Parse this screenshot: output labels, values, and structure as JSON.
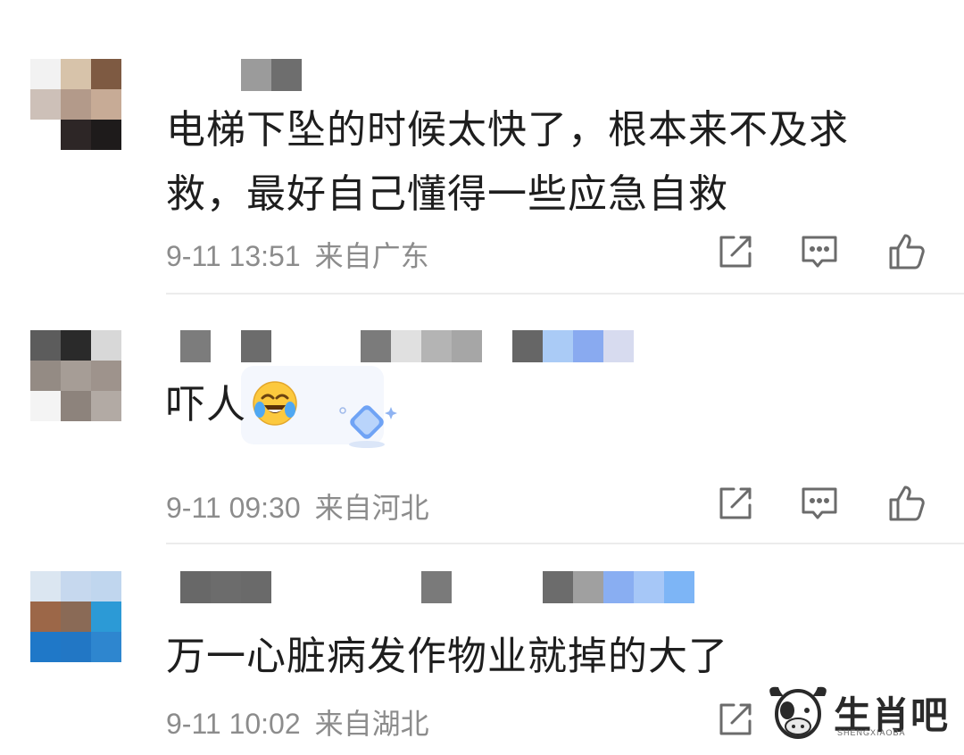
{
  "comments": [
    {
      "text": "电梯下坠的时候太快了，根本来不及求救，最好自己懂得一些应急自救",
      "time": "9-11 13:51",
      "location": "来自广东"
    },
    {
      "text": "吓人",
      "emoji": "laughing-crying-emoji",
      "badge": "diamond-badge",
      "time": "9-11 09:30",
      "location": "来自河北"
    },
    {
      "text": "万一心脏病发作物业就掉的大了",
      "time": "9-11 10:02",
      "location": "来自湖北"
    }
  ],
  "actions": [
    "share-icon",
    "comment-icon",
    "like-icon"
  ],
  "watermark": {
    "title": "生肖吧",
    "subtitle": "SHENGXIAOBA"
  },
  "colors": {
    "text": "#1e1e1e",
    "meta": "#8c8c8c",
    "icon": "#6b6b6b",
    "divider": "#ececec"
  }
}
